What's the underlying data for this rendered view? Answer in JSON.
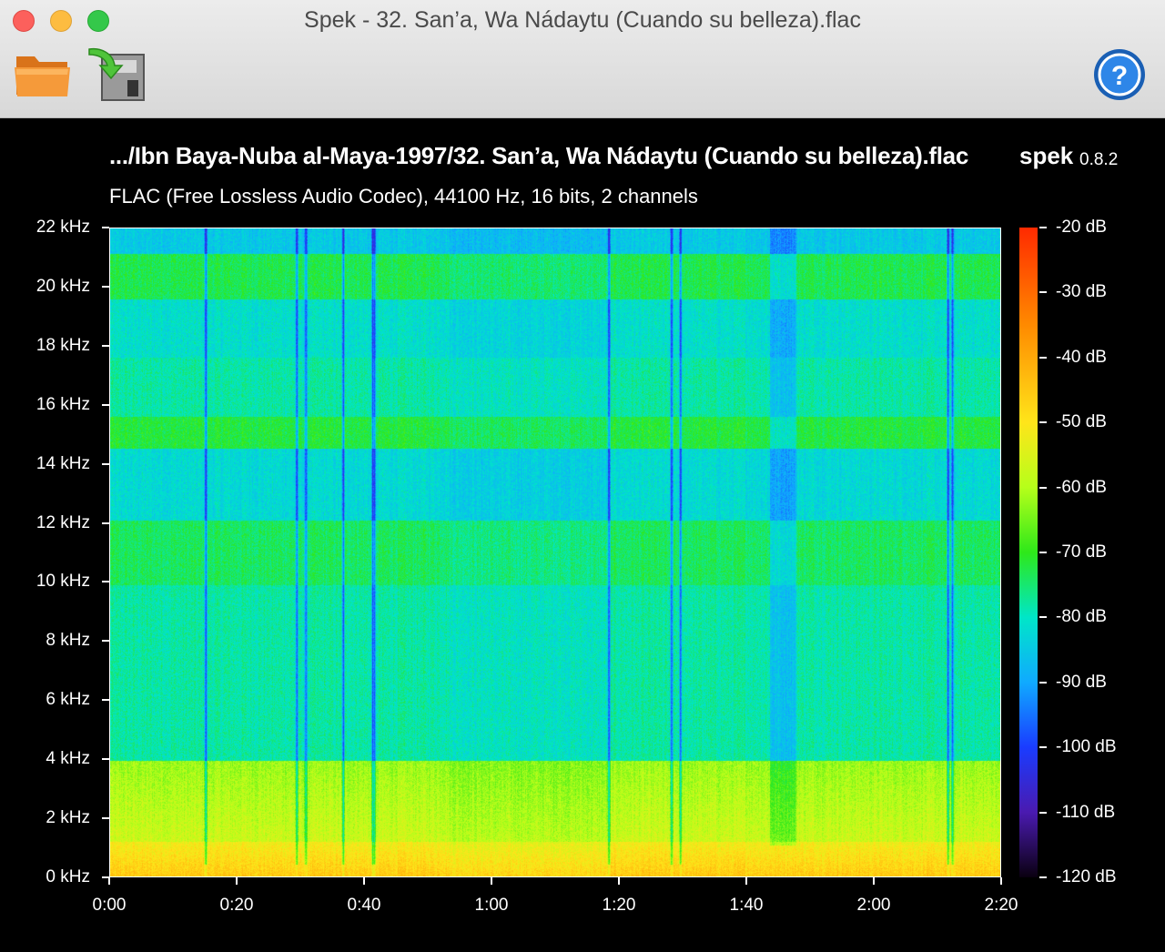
{
  "window": {
    "title": "Spek - 32. San’a, Wa Nádaytu (Cuando su belleza).flac"
  },
  "toolbar": {
    "open_icon": "folder-icon",
    "save_icon": "save-image-icon",
    "help_icon": "help-icon"
  },
  "header": {
    "file_path": ".../Ibn Baya-Nuba al-Maya-1997/32. San’a, Wa Nádaytu (Cuando su belleza).flac",
    "app_name": "spek",
    "app_version": "0.8.2",
    "stream_info": "FLAC (Free Lossless Audio Codec), 44100 Hz, 16 bits, 2 channels"
  },
  "chart_data": {
    "type": "heatmap",
    "yticks": [
      "0 kHz",
      "2 kHz",
      "4 kHz",
      "6 kHz",
      "8 kHz",
      "10 kHz",
      "12 kHz",
      "14 kHz",
      "16 kHz",
      "18 kHz",
      "20 kHz",
      "22 kHz"
    ],
    "xticks": [
      "0:00",
      "0:20",
      "0:40",
      "1:00",
      "1:20",
      "1:40",
      "2:00",
      "2:20"
    ],
    "colorbar_ticks": [
      "-20 dB",
      "-30 dB",
      "-40 dB",
      "-50 dB",
      "-60 dB",
      "-70 dB",
      "-80 dB",
      "-90 dB",
      "-100 dB",
      "-110 dB",
      "-120 dB"
    ],
    "y_range_khz": [
      0,
      22
    ],
    "x_range_seconds": [
      0,
      140
    ],
    "db_range": [
      -120,
      -20
    ]
  }
}
